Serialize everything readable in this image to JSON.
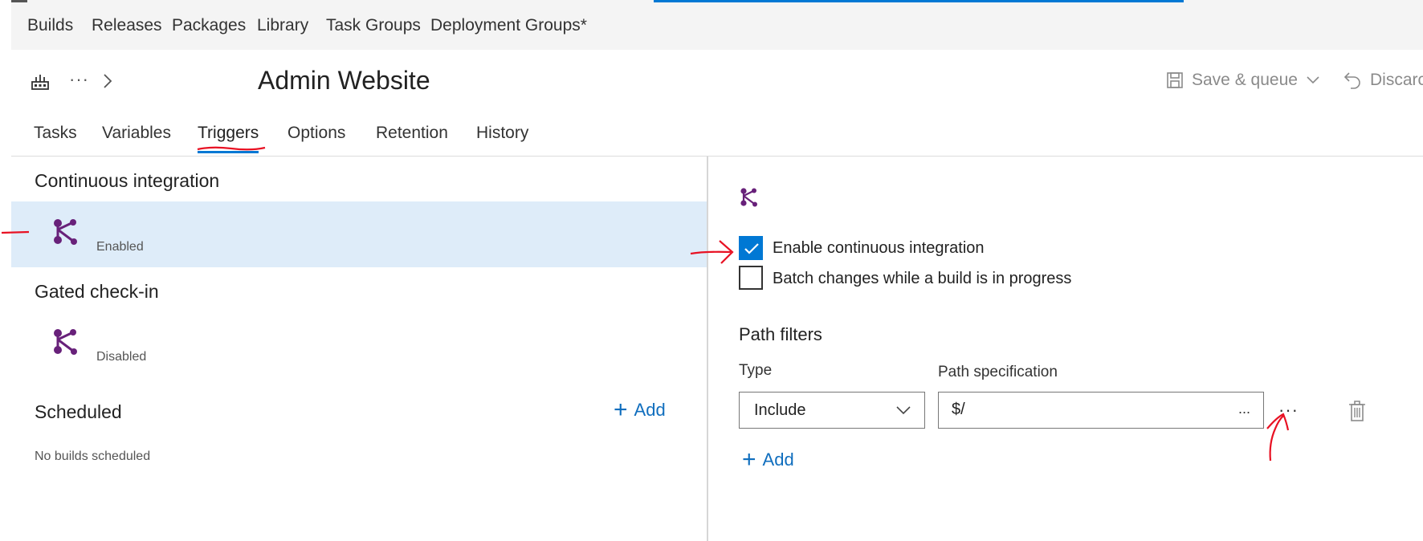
{
  "topnav": {
    "items": [
      "Builds",
      "Releases",
      "Packages",
      "Library",
      "Task Groups",
      "Deployment Groups*"
    ]
  },
  "toolbar": {
    "more": "···",
    "title": "Admin Website",
    "save_queue": "Save & queue",
    "discard": "Discarc"
  },
  "tabs": [
    "Tasks",
    "Variables",
    "Triggers",
    "Options",
    "Retention",
    "History"
  ],
  "active_tab": "Triggers",
  "left": {
    "ci_title": "Continuous integration",
    "ci_status": "Enabled",
    "gated_title": "Gated check-in",
    "gated_status": "Disabled",
    "scheduled_title": "Scheduled",
    "add_label": "Add",
    "no_builds": "No builds scheduled"
  },
  "right": {
    "enable_ci_label": "Enable continuous integration",
    "enable_ci_checked": true,
    "batch_label": "Batch changes while a build is in progress",
    "batch_checked": false,
    "path_filters_title": "Path filters",
    "type_label": "Type",
    "path_spec_label": "Path specification",
    "type_value": "Include",
    "path_value": "$/",
    "browse_label": "...",
    "row_more": "···",
    "add_label": "Add"
  },
  "colors": {
    "accent": "#0078d4",
    "selected_bg": "#deecf9",
    "trigger_icon": "#68217a",
    "link": "#106ebe",
    "annotation": "#e81123"
  },
  "icons": {
    "definition": "build-definition-icon",
    "trigger": "ci-trigger-icon",
    "save": "save-icon",
    "discard": "undo-icon",
    "delete": "trash-icon"
  }
}
